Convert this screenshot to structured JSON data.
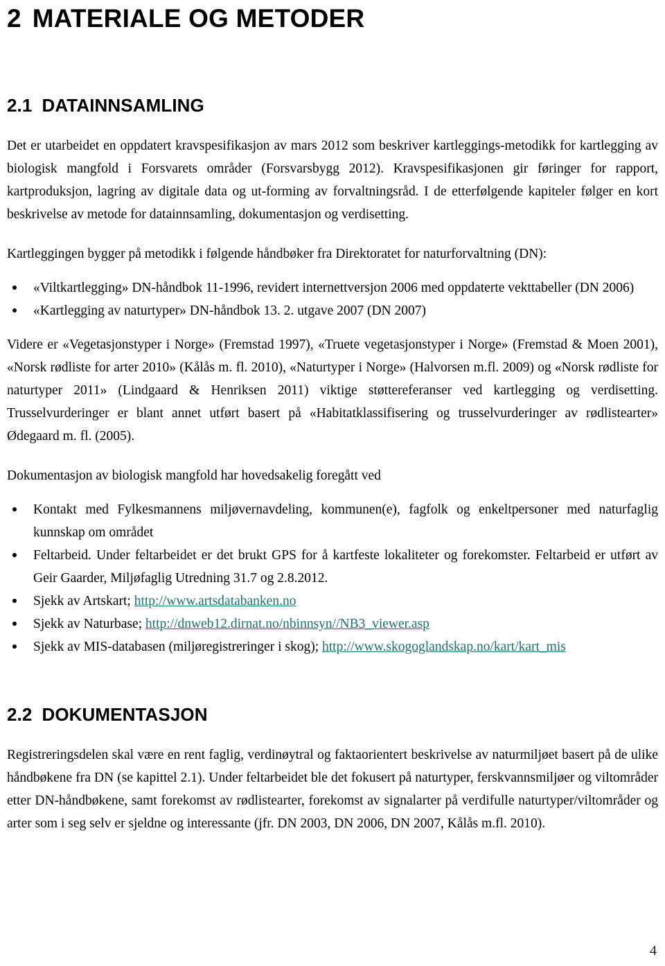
{
  "document": {
    "page_number": "4"
  },
  "chapter": {
    "number": "2",
    "title": "MATERIALE OG METODER"
  },
  "sections": [
    {
      "number": "2.1",
      "title": "DATAINNSAMLING",
      "paragraph_1": "Det er utarbeidet en oppdatert kravspesifikasjon av mars 2012 som beskriver kartleggings-metodikk for kartlegging av biologisk mangfold i Forsvarets områder (Forsvarsbygg 2012). Kravspesifikasjonen gir føringer for rapport, kartproduksjon, lagring av digitale data og ut-forming av forvaltningsråd. I de etterfølgende kapiteler følger en kort beskrivelse av metode for datainnsamling, dokumentasjon og verdisetting.",
      "paragraph_2": "Kartleggingen bygger på metodikk i følgende håndbøker fra Direktoratet for naturforvaltning (DN):",
      "handbook_list": [
        "«Viltkartlegging» DN-håndbok 11-1996, revidert internettversjon 2006 med oppdaterte vekttabeller (DN 2006)",
        "«Kartlegging av naturtyper» DN-håndbok 13. 2. utgave 2007 (DN 2007)"
      ],
      "paragraph_3": "Videre er «Vegetasjonstyper i Norge» (Fremstad 1997), «Truete vegetasjonstyper i Norge» (Fremstad & Moen 2001), «Norsk rødliste for arter 2010» (Kålås m. fl. 2010), «Naturtyper i Norge» (Halvorsen m.fl. 2009) og «Norsk rødliste for naturtyper 2011» (Lindgaard & Henriksen 2011) viktige støttereferanser ved kartlegging og verdisetting. Trusselvurderinger er blant annet utført basert på «Habitatklassifisering og trusselvurderinger av rødlistearter» Ødegaard m. fl. (2005).",
      "paragraph_4": "Dokumentasjon av biologisk mangfold har hovedsakelig foregått ved",
      "documentation_list": [
        {
          "text": "Kontakt med Fylkesmannens miljøvernavdeling, kommunen(e), fagfolk og enkeltpersoner med naturfaglig kunnskap om området",
          "link": null
        },
        {
          "text": "Feltarbeid. Under feltarbeidet er det brukt GPS for å kartfeste lokaliteter og forekomster. Feltarbeid er utført av Geir Gaarder, Miljøfaglig Utredning 31.7 og 2.8.2012.",
          "link": null
        },
        {
          "text": "Sjekk av Artskart; ",
          "link": "http://www.artsdatabanken.no"
        },
        {
          "text": "Sjekk av Naturbase; ",
          "link": "http://dnweb12.dirnat.no/nbinnsyn//NB3_viewer.asp"
        },
        {
          "text": "Sjekk av MIS-databasen (miljøregistreringer i skog); ",
          "link": "http://www.skogoglandskap.no/kart/kart_mis"
        }
      ]
    },
    {
      "number": "2.2",
      "title": "DOKUMENTASJON",
      "paragraph_1": "Registreringsdelen skal være en rent faglig, verdinøytral og faktaorientert beskrivelse av naturmiljøet basert på de ulike håndbøkene fra DN (se kapittel 2.1). Under feltarbeidet ble det fokusert på naturtyper, ferskvannsmiljøer og viltområder etter DN-håndbøkene, samt forekomst av rødlistearter, forekomst av signalarter på verdifulle naturtyper/viltområder og arter som i seg selv er sjeldne og interessante (jfr. DN 2003, DN 2006, DN 2007, Kålås m.fl. 2010)."
    }
  ],
  "colors": {
    "link": "#1f6f70",
    "text": "#000000",
    "background": "#ffffff"
  }
}
